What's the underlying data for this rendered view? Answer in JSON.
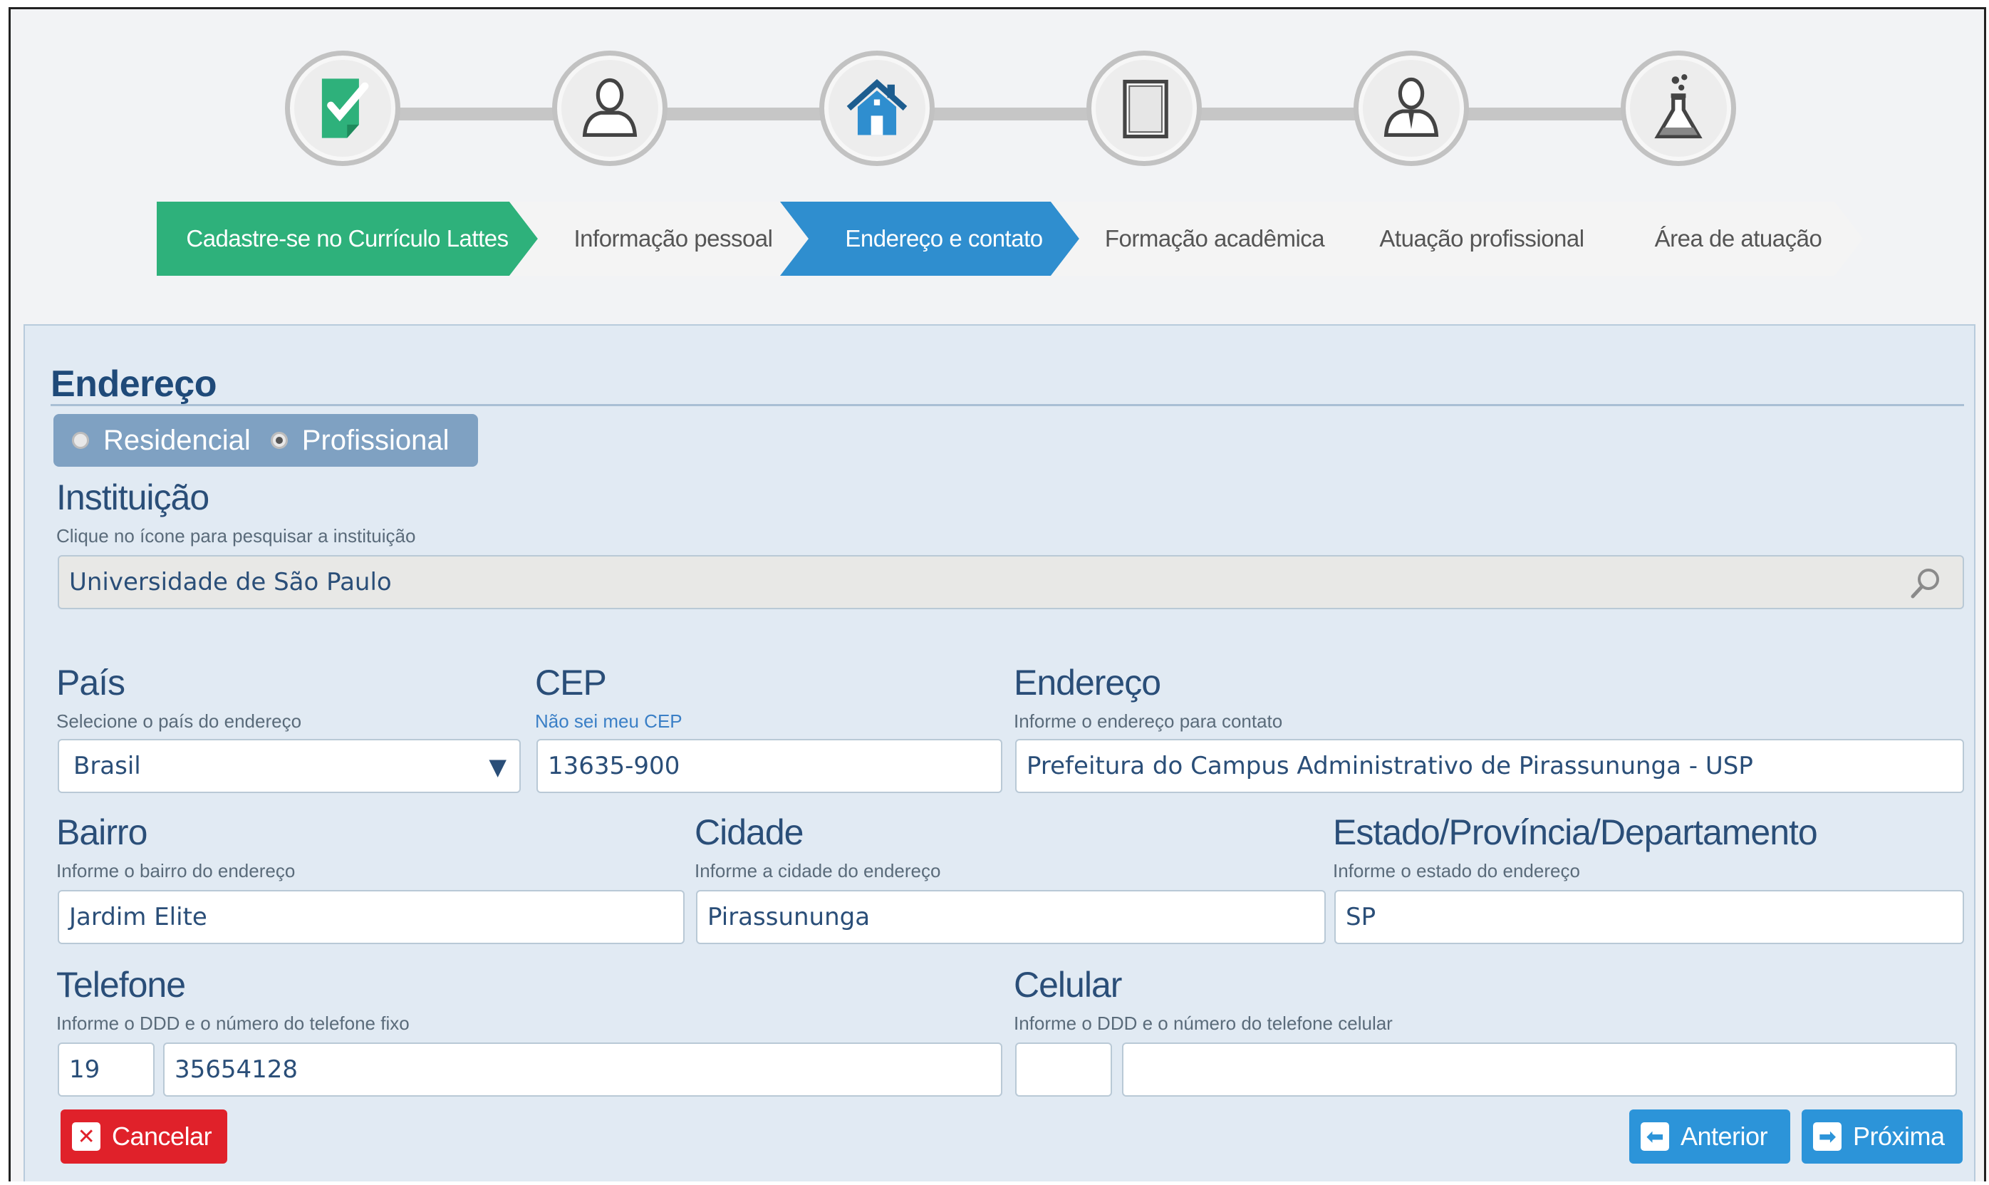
{
  "steps": [
    {
      "icon": "document-check-icon",
      "label": "Cadastre-se no Currículo Lattes"
    },
    {
      "icon": "person-icon",
      "label": "Informação pessoal"
    },
    {
      "icon": "house-icon",
      "label": "Endereço e contato"
    },
    {
      "icon": "book-icon",
      "label": "Formação acadêmica"
    },
    {
      "icon": "professional-icon",
      "label": "Atuação profissional"
    },
    {
      "icon": "flask-icon",
      "label": "Área de atuação"
    }
  ],
  "active_step": 2,
  "colors": {
    "completed": "#2eb17b",
    "active": "#2f8ecf",
    "cancel": "#e0212a",
    "nav": "#2c94d9"
  },
  "section": {
    "title": "Endereço"
  },
  "address_type": {
    "options": [
      "Residencial",
      "Profissional"
    ],
    "selected": "Profissional"
  },
  "instituicao": {
    "label": "Instituição",
    "hint": "Clique no ícone para pesquisar a instituição",
    "value": "Universidade de São Paulo"
  },
  "pais": {
    "label": "País",
    "hint": "Selecione o país do endereço",
    "value": "Brasil"
  },
  "cep": {
    "label": "CEP",
    "hint": "Não sei meu CEP",
    "value": "13635-900"
  },
  "endereco": {
    "label": "Endereço",
    "hint": "Informe o endereço para contato",
    "value": "Prefeitura do Campus Administrativo de Pirassununga - USP"
  },
  "bairro": {
    "label": "Bairro",
    "hint": "Informe o bairro do endereço",
    "value": "Jardim Elite"
  },
  "cidade": {
    "label": "Cidade",
    "hint": "Informe a cidade do endereço",
    "value": "Pirassununga"
  },
  "estado": {
    "label": "Estado/Província/Departamento",
    "hint": "Informe o estado do endereço",
    "value": "SP"
  },
  "telefone": {
    "label": "Telefone",
    "hint": "Informe o DDD e o número do telefone fixo",
    "ddd": "19",
    "numero": "35654128"
  },
  "celular": {
    "label": "Celular",
    "hint": "Informe o DDD e o número do telefone celular",
    "ddd": "",
    "numero": ""
  },
  "buttons": {
    "cancel": "Cancelar",
    "previous": "Anterior",
    "next": "Próxima"
  }
}
